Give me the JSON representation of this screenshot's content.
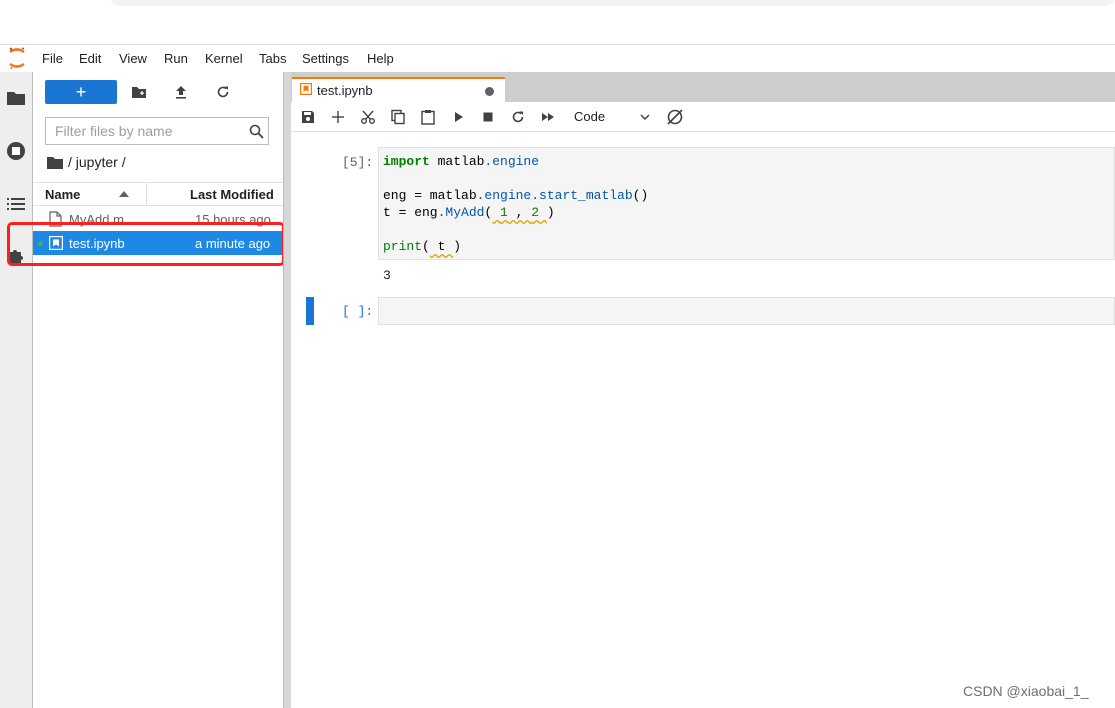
{
  "menubar": {
    "items": [
      "File",
      "Edit",
      "View",
      "Run",
      "Kernel",
      "Tabs",
      "Settings",
      "Help"
    ]
  },
  "filebrowser": {
    "new_button_label": "+",
    "filter_placeholder": "Filter files by name",
    "breadcrumb": "/ jupyter /",
    "columns": {
      "name": "Name",
      "modified": "Last Modified"
    },
    "files": [
      {
        "name": "MyAdd.m",
        "modified": "15 hours ago",
        "selected": false
      },
      {
        "name": "test.ipynb",
        "modified": "a minute ago",
        "selected": true,
        "running": true
      }
    ]
  },
  "notebook": {
    "tab_title": "test.ipynb",
    "cell_type": "Code",
    "cells": [
      {
        "prompt": "[5]:",
        "lines": [
          "import matlab.engine",
          "",
          "eng = matlab.engine.start_matlab()",
          "t = eng.MyAdd( 1 , 2 )",
          "",
          "print( t )"
        ],
        "output": "3"
      },
      {
        "prompt": "[ ]:",
        "lines": [],
        "output": ""
      }
    ]
  },
  "watermark": "CSDN @xiaobai_1_",
  "colors": {
    "accent": "#1976d2",
    "selection": "#1e88e5",
    "highlight_box": "#ff1f1f",
    "tab_accent": "#f57c00"
  }
}
